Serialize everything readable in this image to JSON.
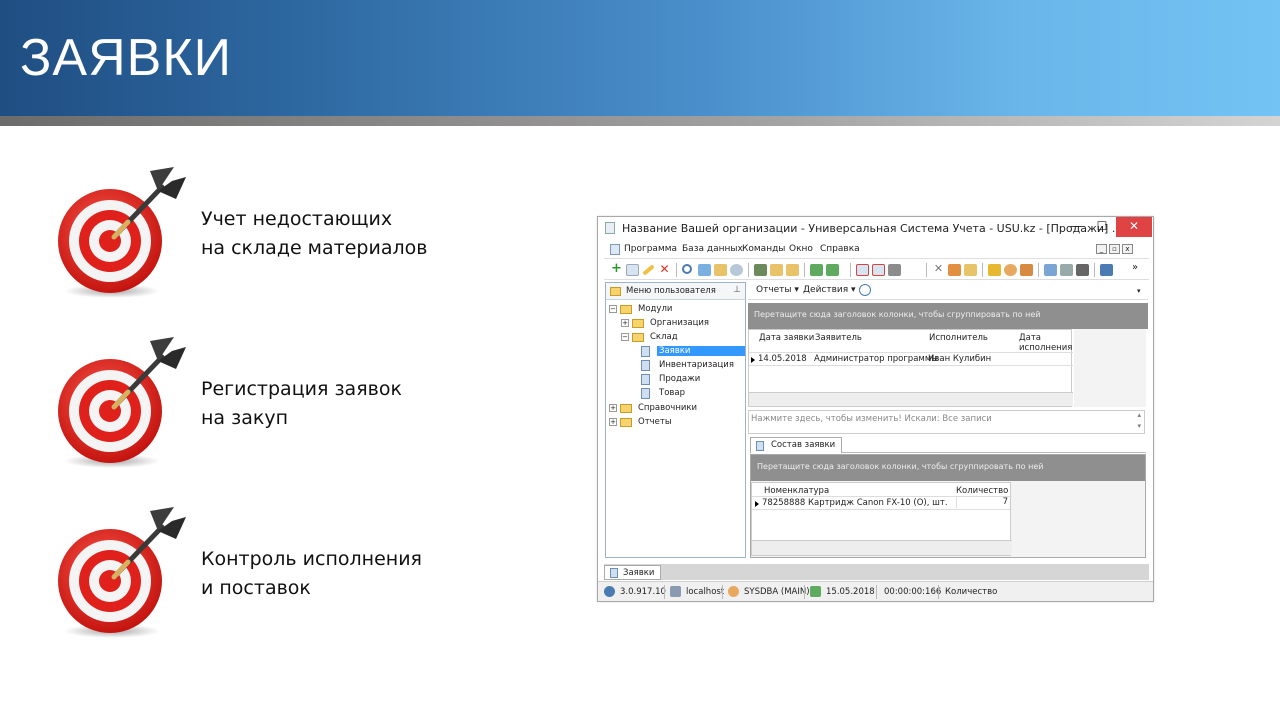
{
  "slide": {
    "title": "ЗАЯВКИ",
    "features": [
      {
        "line1": "Учет недостающих",
        "line2": "на складе материалов"
      },
      {
        "line1": "Регистрация заявок",
        "line2": "на закуп"
      },
      {
        "line1": "Контроль исполнения",
        "line2": "и поставок"
      }
    ]
  },
  "window": {
    "title": "Название Вашей организации - Универсальная Система Учета - USU.kz - [Продажи] ...",
    "controls": {
      "minimize": "—",
      "maximize": "☐",
      "close": "✕"
    },
    "menu": [
      "Программа",
      "База данных",
      "Команды",
      "Окно",
      "Справка"
    ],
    "left_pane": {
      "header": "Меню пользователя",
      "tree": [
        {
          "label": "Модули",
          "expander": "−",
          "icon": "folder"
        },
        {
          "label": "Организация",
          "expander": "+",
          "icon": "folder"
        },
        {
          "label": "Склад",
          "expander": "−",
          "icon": "folder"
        },
        {
          "label": "Заявки",
          "expander": "",
          "icon": "document"
        },
        {
          "label": "Инвентаризация",
          "expander": "",
          "icon": "document"
        },
        {
          "label": "Продажи",
          "expander": "",
          "icon": "document"
        },
        {
          "label": "Товар",
          "expander": "",
          "icon": "document"
        },
        {
          "label": "Справочники",
          "expander": "+",
          "icon": "folder"
        },
        {
          "label": "Отчеты",
          "expander": "+",
          "icon": "folder"
        }
      ]
    },
    "subtoolbar": {
      "reports": "Отчеты ▾",
      "actions": "Действия ▾"
    },
    "group_hint": "Перетащите сюда заголовок колонки, чтобы сгруппировать по ней",
    "requests_grid": {
      "columns": [
        "Дата заявки",
        "Заявитель",
        "Исполнитель",
        "Дата",
        "исполнения"
      ],
      "rows": [
        {
          "date": "14.05.2018",
          "applicant": "Администратор программы",
          "executor": "Иван Кулибин",
          "done_date": ""
        }
      ]
    },
    "filter_text": "Нажмите здесь, чтобы изменить! Искали: Все записи",
    "detail_tab": "Состав заявки",
    "detail_group_hint": "Перетащите сюда заголовок колонки, чтобы сгруппировать по ней",
    "detail_grid": {
      "columns": [
        "Номенклатура",
        "Количество"
      ],
      "rows": [
        {
          "item": "78258888 Картридж Canon FX-10 (O), шт.",
          "qty": "7"
        }
      ]
    },
    "bottom_tab": "Заявки",
    "status": {
      "version": "3.0.917.10",
      "server": "localhost",
      "user": "SYSDBA (MAIN)",
      "date": "15.05.2018",
      "timer": "00:00:00:166",
      "field": "Количество"
    }
  },
  "colors": {
    "header_dark": "#1f4e82",
    "header_light": "#73c3f5",
    "target_red": "#e0201b",
    "selection": "#3399ff",
    "close_button": "#e04343"
  }
}
